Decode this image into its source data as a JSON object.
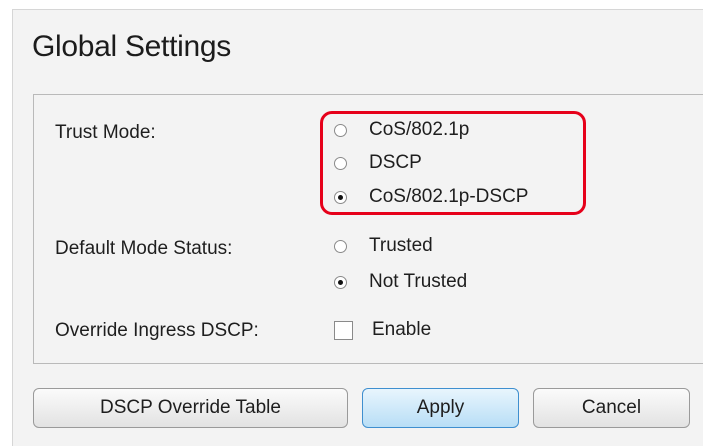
{
  "title": "Global Settings",
  "trust_mode": {
    "label": "Trust Mode:",
    "options": [
      {
        "label": "CoS/802.1p",
        "selected": false
      },
      {
        "label": "DSCP",
        "selected": false
      },
      {
        "label": "CoS/802.1p-DSCP",
        "selected": true
      }
    ],
    "highlight_color": "#e6001a"
  },
  "default_mode_status": {
    "label": "Default Mode Status:",
    "options": [
      {
        "label": "Trusted",
        "selected": false
      },
      {
        "label": "Not Trusted",
        "selected": true
      }
    ]
  },
  "override_ingress_dscp": {
    "label": "Override Ingress DSCP:",
    "checkbox_label": "Enable",
    "checked": false
  },
  "buttons": {
    "dscp_override_table": "DSCP Override Table",
    "apply": "Apply",
    "cancel": "Cancel"
  },
  "colors": {
    "panel_bg": "#f3f3f3",
    "apply_border": "#3f8fcf"
  }
}
